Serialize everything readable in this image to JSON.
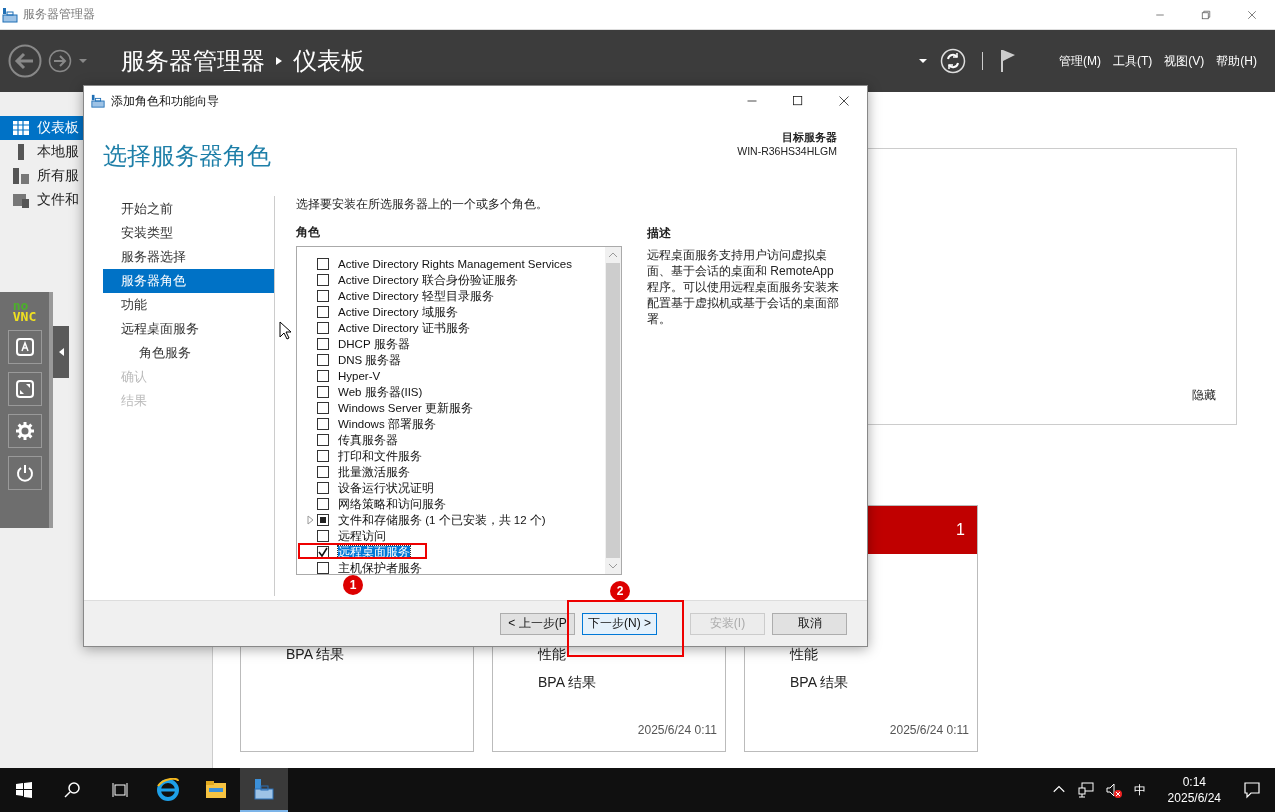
{
  "os_window": {
    "title": "服务器管理器"
  },
  "header": {
    "breadcrumb": [
      "服务器管理器",
      "仪表板"
    ],
    "menu": [
      "管理(M)",
      "工具(T)",
      "视图(V)",
      "帮助(H)"
    ]
  },
  "sidebar": {
    "items": [
      {
        "label": "仪表板",
        "selected": true
      },
      {
        "label": "本地服",
        "selected": false
      },
      {
        "label": "所有服",
        "selected": false
      },
      {
        "label": "文件和",
        "selected": false
      }
    ]
  },
  "welcome_panel": {
    "hide_link": "隐藏"
  },
  "tiles": [
    {
      "lines": [
        "BPA 结果"
      ]
    },
    {
      "lines": [
        "性能",
        "BPA 结果"
      ],
      "timestamp": "2025/6/24 0:11"
    },
    {
      "alert_count": "1",
      "lines": [
        "性能",
        "BPA 结果"
      ],
      "timestamp": "2025/6/24 0:11"
    }
  ],
  "dialog": {
    "title": "添加角色和功能向导",
    "heading": "选择服务器角色",
    "target_label": "目标服务器",
    "target_server": "WIN-R36HS34HLGM",
    "steps": [
      {
        "label": "开始之前",
        "selected": false,
        "disabled": false
      },
      {
        "label": "安装类型",
        "selected": false,
        "disabled": false
      },
      {
        "label": "服务器选择",
        "selected": false,
        "disabled": false
      },
      {
        "label": "服务器角色",
        "selected": true,
        "disabled": false
      },
      {
        "label": "功能",
        "selected": false,
        "disabled": false
      },
      {
        "label": "远程桌面服务",
        "selected": false,
        "disabled": false,
        "children": [
          {
            "label": "角色服务",
            "selected": false,
            "disabled": false
          }
        ]
      },
      {
        "label": "确认",
        "selected": false,
        "disabled": true
      },
      {
        "label": "结果",
        "selected": false,
        "disabled": true
      }
    ],
    "instruction": "选择要安装在所选服务器上的一个或多个角色。",
    "roles_heading": "角色",
    "roles": [
      {
        "kind": "role",
        "label": "Active Directory Rights Management Services",
        "checked": false,
        "indeterminate": false,
        "selected": false
      },
      {
        "kind": "role",
        "label": "Active Directory 联合身份验证服务",
        "checked": false,
        "indeterminate": false,
        "selected": false
      },
      {
        "kind": "role",
        "label": "Active Directory 轻型目录服务",
        "checked": false,
        "indeterminate": false,
        "selected": false
      },
      {
        "kind": "role",
        "label": "Active Directory 域服务",
        "checked": false,
        "indeterminate": false,
        "selected": false
      },
      {
        "kind": "role",
        "label": "Active Directory 证书服务",
        "checked": false,
        "indeterminate": false,
        "selected": false
      },
      {
        "kind": "role",
        "label": "DHCP 服务器",
        "checked": false,
        "indeterminate": false,
        "selected": false
      },
      {
        "kind": "role",
        "label": "DNS 服务器",
        "checked": false,
        "indeterminate": false,
        "selected": false
      },
      {
        "kind": "role",
        "label": "Hyper-V",
        "checked": false,
        "indeterminate": false,
        "selected": false
      },
      {
        "kind": "role",
        "label": "Web 服务器(IIS)",
        "checked": false,
        "indeterminate": false,
        "selected": false
      },
      {
        "kind": "role",
        "label": "Windows Server 更新服务",
        "checked": false,
        "indeterminate": false,
        "selected": false
      },
      {
        "kind": "role",
        "label": "Windows 部署服务",
        "checked": false,
        "indeterminate": false,
        "selected": false
      },
      {
        "kind": "role",
        "label": "传真服务器",
        "checked": false,
        "indeterminate": false,
        "selected": false
      },
      {
        "kind": "role",
        "label": "打印和文件服务",
        "checked": false,
        "indeterminate": false,
        "selected": false
      },
      {
        "kind": "role",
        "label": "批量激活服务",
        "checked": false,
        "indeterminate": false,
        "selected": false
      },
      {
        "kind": "role",
        "label": "设备运行状况证明",
        "checked": false,
        "indeterminate": false,
        "selected": false
      },
      {
        "kind": "role",
        "label": "网络策略和访问服务",
        "checked": false,
        "indeterminate": false,
        "selected": false
      },
      {
        "kind": "group",
        "label": "文件和存储服务 (1 个已安装，共 12 个)",
        "checked": false,
        "indeterminate": true,
        "selected": false
      },
      {
        "kind": "role",
        "label": "远程访问",
        "checked": false,
        "indeterminate": false,
        "selected": false
      },
      {
        "kind": "role",
        "label": "远程桌面服务",
        "checked": true,
        "indeterminate": false,
        "selected": true
      },
      {
        "kind": "role",
        "label": "主机保护者服务",
        "checked": false,
        "indeterminate": false,
        "selected": false
      }
    ],
    "description_heading": "描述",
    "description": "远程桌面服务支持用户访问虚拟桌面、基于会话的桌面和 RemoteApp 程序。可以使用远程桌面服务安装来配置基于虚拟机或基于会话的桌面部署。",
    "buttons": [
      {
        "label": "< 上一步(P",
        "disabled": false,
        "focused": false
      },
      {
        "label": "下一步(N) >",
        "disabled": false,
        "focused": true
      },
      {
        "label": "安装(I)",
        "disabled": true,
        "focused": false
      },
      {
        "label": "取消",
        "disabled": false,
        "focused": false
      }
    ]
  },
  "annotations": [
    {
      "number": "1"
    },
    {
      "number": "2"
    }
  ],
  "novnc": {
    "logo_top": "no",
    "logo_bottom": "VNC"
  },
  "taskbar": {
    "apps": [
      {
        "kind": "ie",
        "active": false
      },
      {
        "kind": "explorer",
        "active": false
      },
      {
        "kind": "server-manager",
        "active": true
      }
    ],
    "ime": "中",
    "time": "0:14",
    "date": "2025/6/24"
  }
}
